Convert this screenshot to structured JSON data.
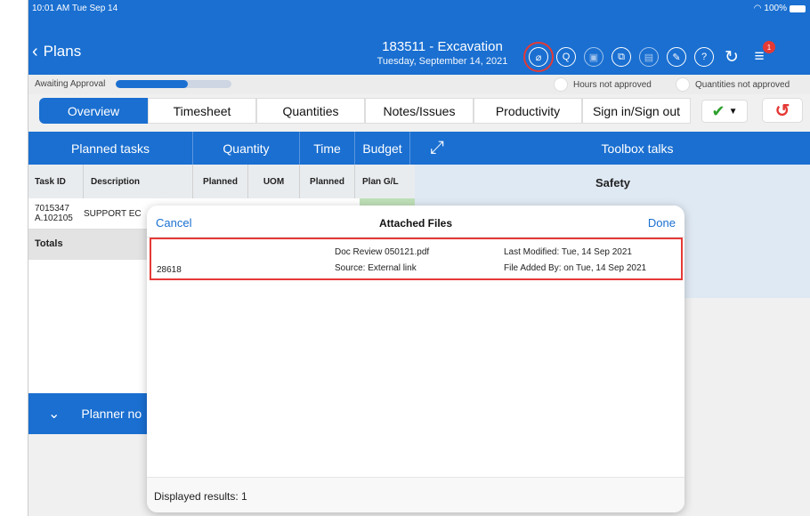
{
  "status_bar": {
    "time": "10:01 AM  Tue Sep 14",
    "battery": "100%"
  },
  "header": {
    "back_label": "Plans",
    "title": "183511 - Excavation",
    "subtitle": "Tuesday, September 14, 2021",
    "notification_count": "1",
    "icons": [
      "attachment-icon",
      "search-doc-icon",
      "photo-icon",
      "copy-icon",
      "delete-icon",
      "edit-icon",
      "help-icon",
      "refresh-icon",
      "menu-icon"
    ]
  },
  "status_row": {
    "status_label": "Awaiting Approval",
    "progress": 0.62,
    "hours_toggle": "Hours not approved",
    "quantities_toggle": "Quantities not approved"
  },
  "tabs": [
    "Overview",
    "Timesheet",
    "Quantities",
    "Notes/Issues",
    "Productivity",
    "Sign in/Sign out"
  ],
  "grid": {
    "headers": [
      "Planned tasks",
      "Quantity",
      "Time",
      "Budget",
      "Toolbox talks"
    ],
    "subheaders": [
      "Task ID",
      "Description",
      "Planned",
      "UOM",
      "Planned",
      "Plan G/L"
    ],
    "row": {
      "task_id_line1": "7015347",
      "task_id_line2": "A.102105",
      "description": "SUPPORT EC"
    },
    "totals_label": "Totals",
    "safety_label": "Safety",
    "planner_notes_label": "Planner no"
  },
  "modal": {
    "cancel": "Cancel",
    "title": "Attached Files",
    "done": "Done",
    "files": [
      {
        "id": "28618",
        "name": "Doc Review 050121.pdf",
        "source": "Source: External link",
        "modified": "Last Modified: Tue, 14 Sep 2021",
        "added": "File Added By:  on  Tue, 14 Sep 2021"
      }
    ],
    "footer": "Displayed results: 1"
  },
  "colors": {
    "brand": "#1a6fd1",
    "alert": "#e53935",
    "ok": "#2ca02c"
  }
}
